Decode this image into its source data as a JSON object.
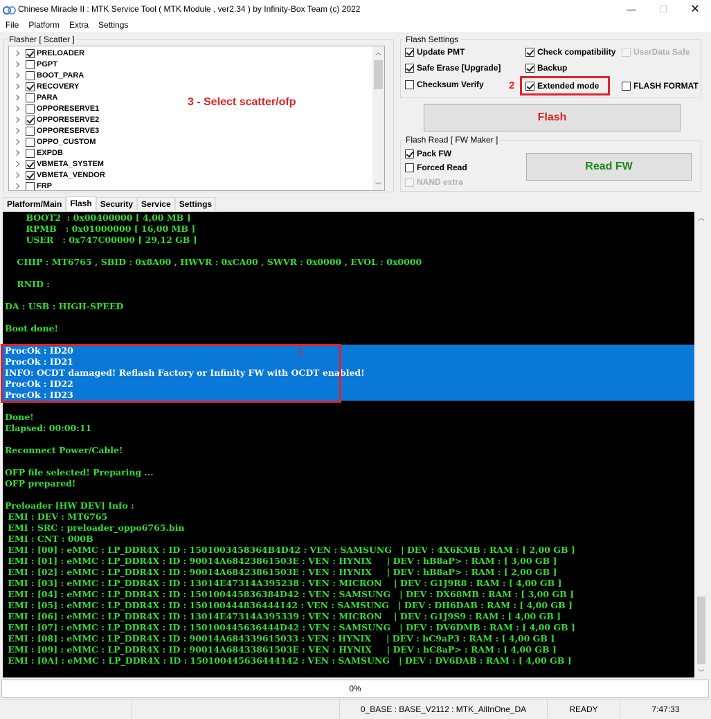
{
  "window": {
    "title": "Chinese Miracle II : MTK Service Tool ( MTK Module , ver2.34  ) by Infinity-Box Team (c) 2022",
    "minimize": "—",
    "maximize": "☐",
    "close": "✕"
  },
  "menu": [
    "File",
    "Platform",
    "Extra",
    "Settings"
  ],
  "flasher": {
    "legend": "Flasher [ Scatter ]",
    "items": [
      {
        "label": "PRELOADER",
        "checked": true
      },
      {
        "label": "PGPT",
        "checked": false
      },
      {
        "label": "BOOT_PARA",
        "checked": false
      },
      {
        "label": "RECOVERY",
        "checked": true
      },
      {
        "label": "PARA",
        "checked": false
      },
      {
        "label": "OPPORESERVE1",
        "checked": false
      },
      {
        "label": "OPPORESERVE2",
        "checked": true
      },
      {
        "label": "OPPORESERVE3",
        "checked": false
      },
      {
        "label": "OPPO_CUSTOM",
        "checked": false
      },
      {
        "label": "EXPDB",
        "checked": false
      },
      {
        "label": "VBMETA_SYSTEM",
        "checked": true
      },
      {
        "label": "VBMETA_VENDOR",
        "checked": true
      },
      {
        "label": "FRP",
        "checked": false
      }
    ],
    "annotation": "3  - Select scatter/ofp"
  },
  "flash_settings": {
    "legend": "Flash Settings",
    "options": {
      "update_pmt": {
        "label": "Update PMT",
        "checked": true
      },
      "check_compat": {
        "label": "Check compatibility",
        "checked": true
      },
      "userdata_safe": {
        "label": "UserData Safe",
        "checked": false
      },
      "safe_erase": {
        "label": "Safe Erase [Upgrade]",
        "checked": true
      },
      "backup": {
        "label": "Backup",
        "checked": true
      },
      "checksum": {
        "label": "Checksum Verify",
        "checked": false
      },
      "extended": {
        "label": "Extended mode",
        "checked": true
      },
      "flash_format": {
        "label": "FLASH FORMAT",
        "checked": false
      }
    },
    "annotation": "2",
    "flash_button": "Flash",
    "flash_color": "#e02020"
  },
  "flash_read": {
    "legend": "Flash Read [ FW Maker ]",
    "options": {
      "pack_fw": {
        "label": "Pack FW",
        "checked": true
      },
      "forced_read": {
        "label": "Forced Read",
        "checked": false
      },
      "nand_extra": {
        "label": "NAND extra",
        "checked": false
      }
    },
    "read_button": "Read FW",
    "read_color": "#1a8a1a"
  },
  "tabs": [
    "Platform/Main",
    "Flash",
    "Security",
    "Service",
    "Settings"
  ],
  "active_tab": "Flash",
  "console": {
    "lines": [
      "       BOOT2  : 0x00400000 [ 4,00 MB ]",
      "       RPMB   : 0x01000000 [ 16,00 MB ]",
      "       USER   : 0x747C00000 [ 29,12 GB ]",
      "",
      "    CHIP : MT6765 , SBID : 0x8A00 , HWVR : 0xCA00 , SWVR : 0x0000 , EVOL : 0x0000",
      "",
      "    RNID :",
      "",
      "DA : USB : HIGH-SPEED",
      "",
      "Boot done!",
      "",
      "ProcOk : ID20",
      "ProcOk : ID21",
      "INFO: OCDT damaged! Reflash Factory or Infinity FW with OCDT enabled!",
      "ProcOk : ID22",
      "ProcOk : ID23",
      "",
      "Done!",
      "Elapsed: 00:00:11",
      "",
      "Reconnect Power/Cable!",
      "",
      "OFP file selected! Preparing ...",
      "OFP prepared!",
      "",
      "Preloader [HW DEV] Info :",
      " EMI : DEV : MT6765",
      " EMI : SRC : preloader_oppo6765.bin",
      " EMI : CNT : 000B",
      " EMI : [00] : eMMC : LP_DDR4X : ID : 1501003458364B4D42 : VEN : SAMSUNG   | DEV : 4X6KMB : RAM : [ 2,00 GB ]",
      " EMI : [01] : eMMC : LP_DDR4X : ID : 90014A68423861503E : VEN : HYNIX     | DEV : hB8aP> : RAM : [ 3,00 GB ]",
      " EMI : [02] : eMMC : LP_DDR4X : ID : 90014A68423861503E : VEN : HYNIX     | DEV : hB8aP> : RAM : [ 2,00 GB ]",
      " EMI : [03] : eMMC : LP_DDR4X : ID : 13014E47314A395238 : VEN : MICRON    | DEV : G1J9R8 : RAM : [ 4,00 GB ]",
      " EMI : [04] : eMMC : LP_DDR4X : ID : 150100445836384D42 : VEN : SAMSUNG   | DEV : DX68MB : RAM : [ 3,00 GB ]",
      " EMI : [05] : eMMC : LP_DDR4X : ID : 150100444836444142 : VEN : SAMSUNG   | DEV : DH6DAB : RAM : [ 4,00 GB ]",
      " EMI : [06] : eMMC : LP_DDR4X : ID : 13014E47314A395339 : VEN : MICRON    | DEV : G1J9S9 : RAM : [ 4,00 GB ]",
      " EMI : [07] : eMMC : LP_DDR4X : ID : 150100445636444D42 : VEN : SAMSUNG   | DEV : DV6DMB : RAM : [ 4,00 GB ]",
      " EMI : [08] : eMMC : LP_DDR4X : ID : 90014A684339615033 : VEN : HYNIX     | DEV : hC9aP3 : RAM : [ 4,00 GB ]",
      " EMI : [09] : eMMC : LP_DDR4X : ID : 90014A68433861503E : VEN : HYNIX     | DEV : hC8aP> : RAM : [ 4,00 GB ]",
      " EMI : [0A] : eMMC : LP_DDR4X : ID : 150100445636444142 : VEN : SAMSUNG   | DEV : DV6DAB : RAM : [ 4,00 GB ]"
    ],
    "highlight_lines": [
      12,
      13,
      14,
      15,
      16
    ],
    "annotation": "1",
    "text_color": "#33dd33",
    "highlight_color": "#0a78d7"
  },
  "progress": {
    "value": 0,
    "label": "0%"
  },
  "status": {
    "base": "0_BASE : BASE_V2112 : MTK_AllInOne_DA",
    "state": "READY",
    "time": "7:47:33"
  },
  "colors": {
    "annotation_red": "#e0202b"
  }
}
